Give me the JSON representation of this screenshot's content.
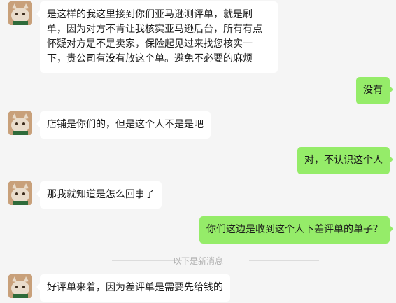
{
  "messages": [
    {
      "side": "left",
      "text": "是这样的我这里接到你们亚马逊测评单，就是刷单，因为对方不肯让我核实亚马逊后台，所有有点怀疑对方是不是卖家，保险起见过来找您核实一下，贵公司有没有放这个单。避免不必要的麻烦"
    },
    {
      "side": "right",
      "text": "没有"
    },
    {
      "side": "left",
      "text": "店铺是你们的，但是这个人不是是吧"
    },
    {
      "side": "right",
      "text": "对，不认识这个人"
    },
    {
      "side": "left",
      "text": "那我就知道是怎么回事了"
    },
    {
      "side": "right",
      "text": "你们这边是收到这个人下差评单的单子？"
    },
    {
      "side": "left",
      "text": "好评单来着，因为差评单是需要先给钱的"
    }
  ],
  "divider": {
    "text": "以下是新消息"
  },
  "colors": {
    "right_bubble": "#95ec69",
    "left_bubble": "#ffffff",
    "background": "#f5f5f5"
  }
}
